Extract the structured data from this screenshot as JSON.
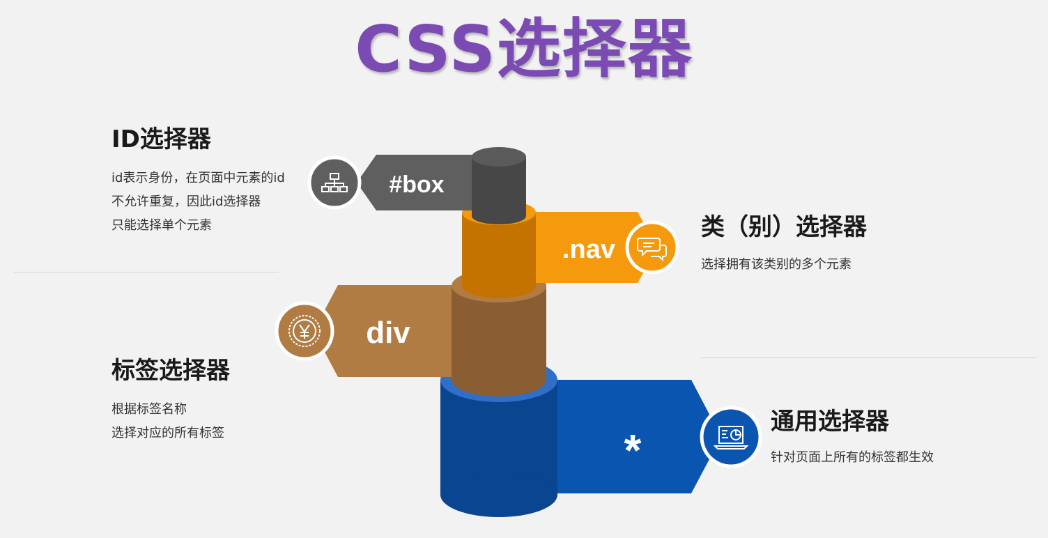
{
  "title": "CSS选择器",
  "selectors": {
    "id": {
      "heading": "ID选择器",
      "lines": [
        "id表示身份，在页面中元素的id",
        "不允许重复，因此id选择器",
        "只能选择单个元素"
      ],
      "example": "#box",
      "color": "#5f5f5f",
      "icon": "sitemap-icon"
    },
    "class": {
      "heading": "类（别）选择器",
      "lines": [
        "选择拥有该类别的多个元素"
      ],
      "example": ".nav",
      "color": "#f59a0c",
      "icon": "chat-bubbles-icon"
    },
    "tag": {
      "heading": "标签选择器",
      "lines": [
        "根据标签名称",
        "选择对应的所有标签"
      ],
      "example": "div",
      "color": "#b07c44",
      "icon": "yen-coin-icon"
    },
    "universal": {
      "heading": "通用选择器",
      "lines": [
        "针对页面上所有的标签都生效"
      ],
      "example": "*",
      "color": "#0a55b0",
      "icon": "presentation-chart-icon"
    }
  }
}
